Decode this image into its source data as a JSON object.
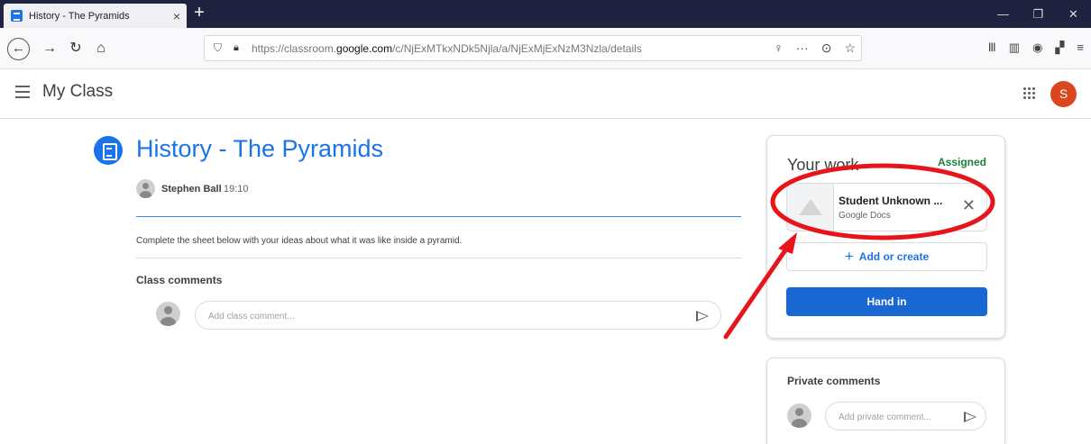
{
  "browser": {
    "tab_title": "History - The Pyramids",
    "tab_close": "×",
    "new_tab": "+",
    "url_prefix": "https://classroom.",
    "url_domain": "google.com",
    "url_path": "/c/NjExMTkxNDk5Njla/a/NjExMjExNzM3Nzla/details"
  },
  "header": {
    "class_name": "My Class",
    "avatar_letter": "S"
  },
  "assignment": {
    "title": "History - The Pyramids",
    "author": "Stephen Ball",
    "time": "19:10",
    "instructions": "Complete the sheet below with your ideas about what it was like inside a pyramid.",
    "comments_label": "Class comments",
    "comment_placeholder": "Add class comment..."
  },
  "your_work": {
    "title": "Your work",
    "status": "Assigned",
    "attachment_name": "Student Unknown ...",
    "attachment_type": "Google Docs",
    "add_label": "Add or create",
    "hand_in_label": "Hand in"
  },
  "private_comments": {
    "title": "Private comments",
    "placeholder": "Add private comment..."
  },
  "colors": {
    "brand_blue": "#1a73e8",
    "status_green": "#188038",
    "annotation_red": "#e8141b",
    "avatar_orange": "#d9461f"
  },
  "icons": [
    "menu-icon",
    "apps-icon",
    "assignment-icon",
    "send-icon",
    "close-icon",
    "plus-icon",
    "back-icon",
    "forward-icon",
    "reload-icon",
    "home-icon",
    "lock-icon",
    "shield-icon",
    "bookmark-star-icon"
  ]
}
